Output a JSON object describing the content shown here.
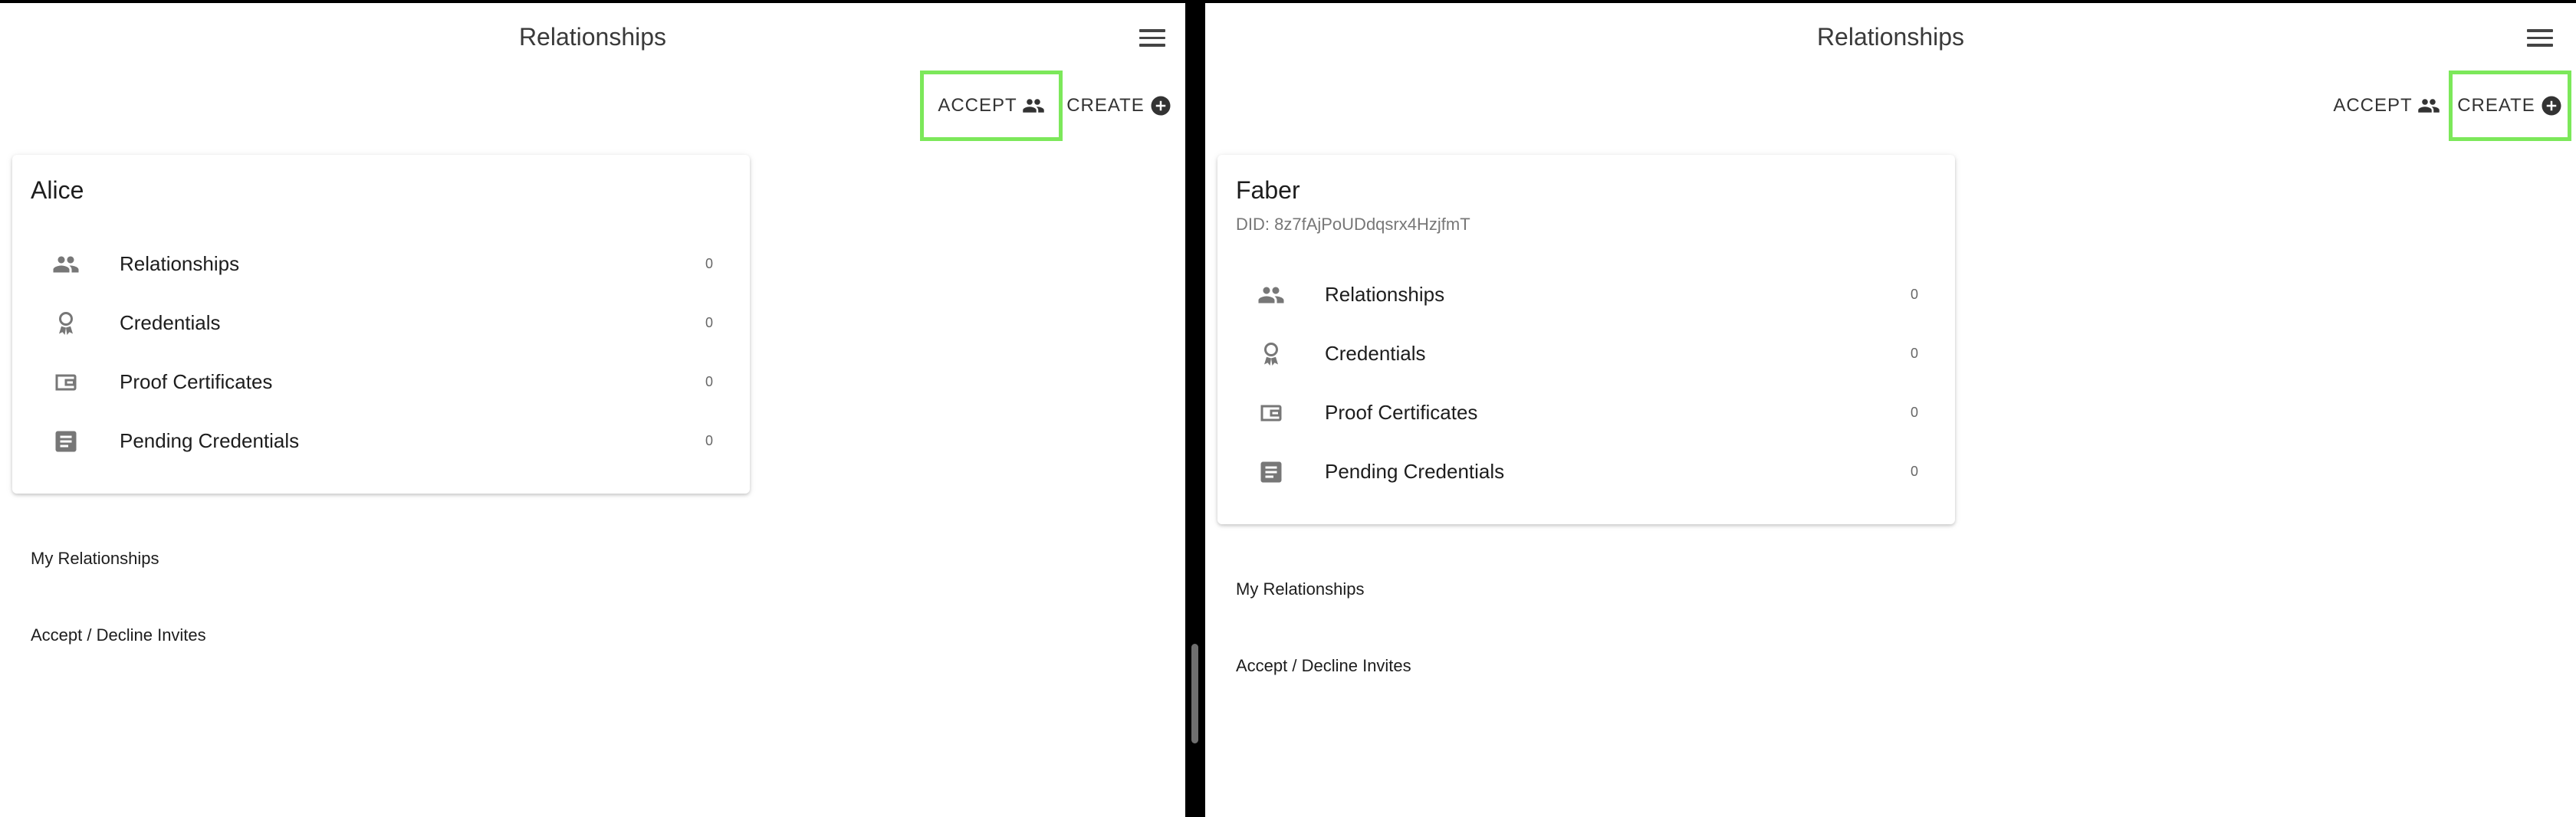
{
  "left_pane": {
    "title": "Relationships",
    "accept_label": "ACCEPT",
    "create_label": "CREATE",
    "card": {
      "name": "Alice",
      "rows": [
        {
          "icon": "people-icon",
          "label": "Relationships",
          "count": "0"
        },
        {
          "icon": "award-icon",
          "label": "Credentials",
          "count": "0"
        },
        {
          "icon": "wallet-icon",
          "label": "Proof Certificates",
          "count": "0"
        },
        {
          "icon": "document-icon",
          "label": "Pending Credentials",
          "count": "0"
        }
      ]
    },
    "links": {
      "my_relationships": "My Relationships",
      "accept_decline": "Accept / Decline Invites"
    }
  },
  "right_pane": {
    "title": "Relationships",
    "accept_label": "ACCEPT",
    "create_label": "CREATE",
    "card": {
      "name": "Faber",
      "did": "DID: 8z7fAjPoUDdqsrx4HzjfmT",
      "rows": [
        {
          "icon": "people-icon",
          "label": "Relationships",
          "count": "0"
        },
        {
          "icon": "award-icon",
          "label": "Credentials",
          "count": "0"
        },
        {
          "icon": "wallet-icon",
          "label": "Proof Certificates",
          "count": "0"
        },
        {
          "icon": "document-icon",
          "label": "Pending Credentials",
          "count": "0"
        }
      ]
    },
    "links": {
      "my_relationships": "My Relationships",
      "accept_decline": "Accept / Decline Invites"
    }
  },
  "colors": {
    "highlight": "#7ce85a",
    "divider": "#000000",
    "icon": "#777777"
  }
}
